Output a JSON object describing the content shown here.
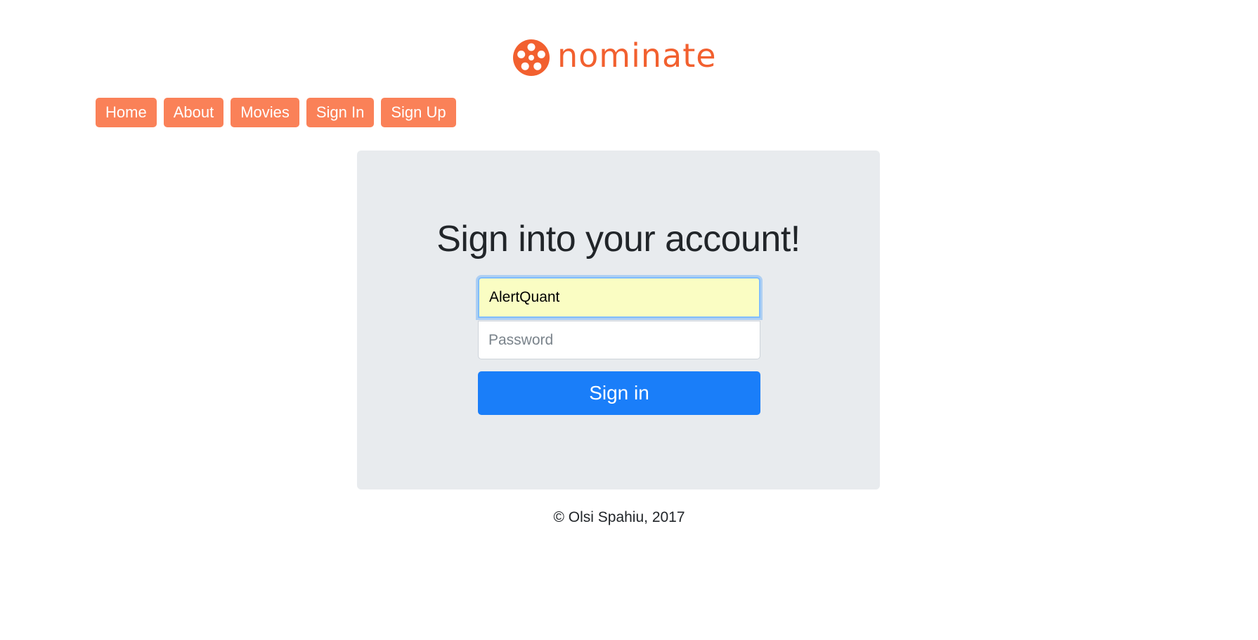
{
  "brand": {
    "name": "nominate",
    "color": "#f2602f",
    "logo_icon": "film-reel-icon"
  },
  "nav": {
    "items": [
      {
        "label": "Home"
      },
      {
        "label": "About"
      },
      {
        "label": "Movies"
      },
      {
        "label": "Sign In"
      },
      {
        "label": "Sign Up"
      }
    ],
    "button_color": "#fa8158"
  },
  "signin_form": {
    "title": "Sign into your account!",
    "username_value": "AlertQuant",
    "password_placeholder": "Password",
    "submit_label": "Sign in",
    "submit_color": "#1a7ef9",
    "panel_color": "#e8ebee"
  },
  "footer": {
    "text": "© Olsi Spahiu, 2017"
  }
}
